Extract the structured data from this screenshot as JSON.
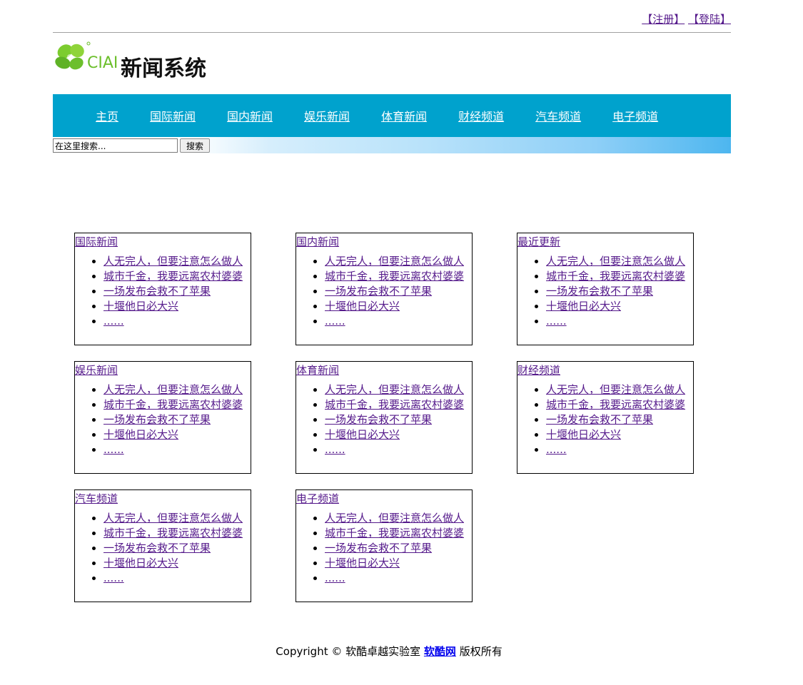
{
  "header": {
    "register_label": "【注册】",
    "login_label": "【登陆】",
    "logo_brand": "CIAI",
    "logo_title": "新闻系统"
  },
  "nav": {
    "items": [
      {
        "label": "主页"
      },
      {
        "label": "国际新闻"
      },
      {
        "label": "国内新闻"
      },
      {
        "label": "娱乐新闻"
      },
      {
        "label": "体育新闻"
      },
      {
        "label": "财经频道"
      },
      {
        "label": "汽车频道"
      },
      {
        "label": "电子频道"
      }
    ]
  },
  "search": {
    "value": "在这里搜索...",
    "button_label": "搜索"
  },
  "sections": [
    {
      "title": "国际新闻",
      "items": [
        "人无完人，但要注意怎么做人",
        "城市千金，我要远离农村婆婆",
        "一场发布会救不了苹果",
        "十堰他日必大兴",
        "......"
      ]
    },
    {
      "title": "国内新闻",
      "items": [
        "人无完人，但要注意怎么做人",
        "城市千金，我要远离农村婆婆",
        "一场发布会救不了苹果",
        "十堰他日必大兴",
        "......"
      ]
    },
    {
      "title": "最近更新",
      "items": [
        "人无完人，但要注意怎么做人",
        "城市千金，我要远离农村婆婆",
        "一场发布会救不了苹果",
        "十堰他日必大兴",
        "......"
      ]
    },
    {
      "title": "娱乐新闻",
      "items": [
        "人无完人，但要注意怎么做人",
        "城市千金，我要远离农村婆婆",
        "一场发布会救不了苹果",
        "十堰他日必大兴",
        "......"
      ]
    },
    {
      "title": "体育新闻",
      "items": [
        "人无完人，但要注意怎么做人",
        "城市千金，我要远离农村婆婆",
        "一场发布会救不了苹果",
        "十堰他日必大兴",
        "......"
      ]
    },
    {
      "title": "财经频道",
      "items": [
        "人无完人，但要注意怎么做人",
        "城市千金，我要远离农村婆婆",
        "一场发布会救不了苹果",
        "十堰他日必大兴",
        "......"
      ]
    },
    {
      "title": "汽车频道",
      "items": [
        "人无完人，但要注意怎么做人",
        "城市千金，我要远离农村婆婆",
        "一场发布会救不了苹果",
        "十堰他日必大兴",
        "......"
      ]
    },
    {
      "title": "电子频道",
      "items": [
        "人无完人，但要注意怎么做人",
        "城市千金，我要远离农村婆婆",
        "一场发布会救不了苹果",
        "十堰他日必大兴",
        "......"
      ]
    }
  ],
  "footer": {
    "prefix": "Copyright © 软酷卓越实验室 ",
    "link_label": "软酷网",
    "suffix": " 版权所有"
  },
  "colors": {
    "nav_background": "#00a2cd",
    "visited_link": "#551a8b",
    "logo_green": "#6cbf2c"
  },
  "icons": {
    "logo": "clover-logo-icon"
  }
}
